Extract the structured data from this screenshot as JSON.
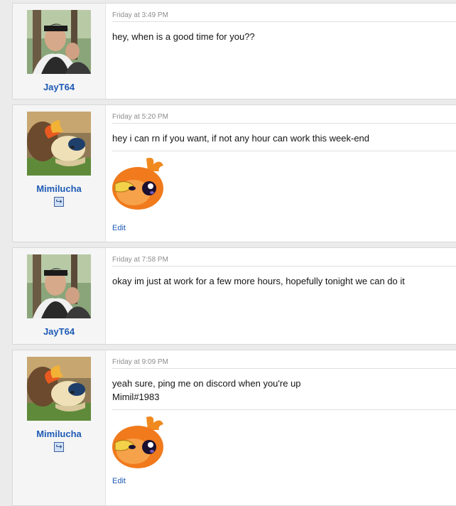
{
  "posts": [
    {
      "timestamp": "Friday at 3:49 PM",
      "username": "JayT64",
      "message": "hey, when is a good time for you??"
    },
    {
      "timestamp": "Friday at 5:20 PM",
      "username": "Mimilucha",
      "message": "hey i can rn if you want, if not any hour can work this week-end",
      "edit_label": "Edit"
    },
    {
      "timestamp": "Friday at 7:58 PM",
      "username": "JayT64",
      "message": "okay im just at work for a few more hours, hopefully tonight we can do it"
    },
    {
      "timestamp": "Friday at 9:09 PM",
      "username": "Mimilucha",
      "message": "yeah sure, ping me on discord when you're up\nMimil#1983",
      "edit_label": "Edit"
    }
  ]
}
